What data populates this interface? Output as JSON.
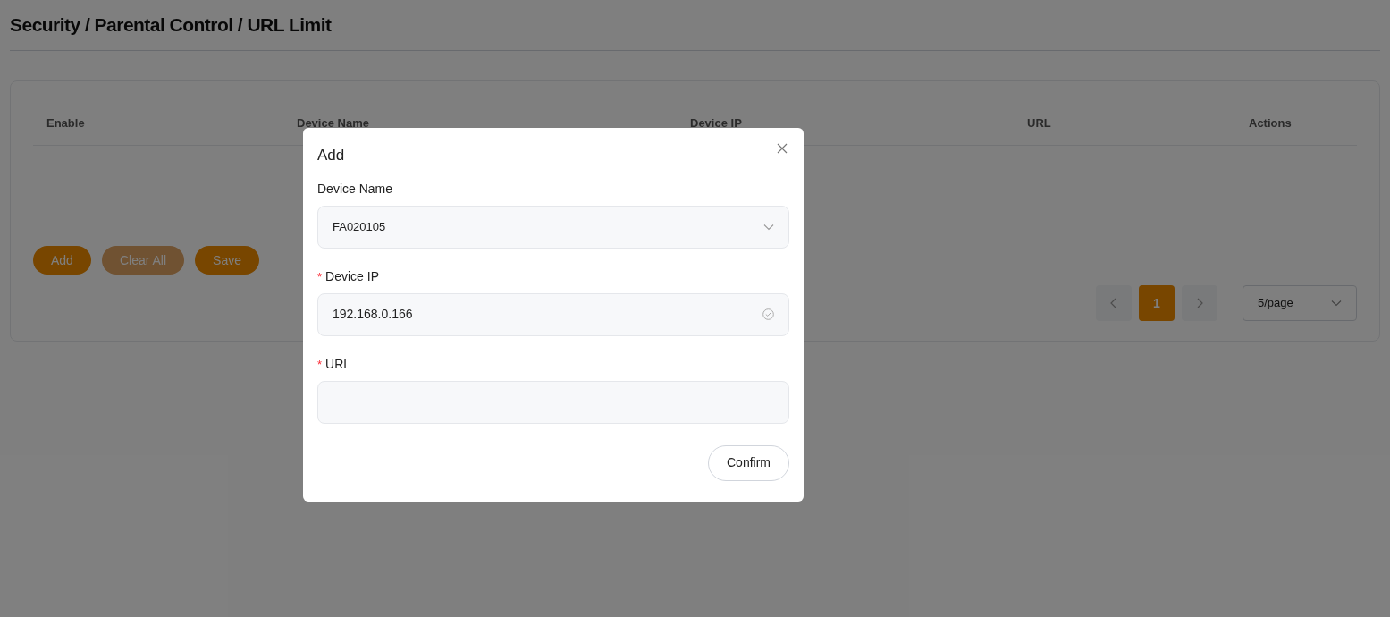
{
  "page_title": "Security / Parental Control / URL Limit",
  "table": {
    "columns": [
      "Enable",
      "Device Name",
      "Device IP",
      "URL",
      "Actions"
    ]
  },
  "buttons": [
    {
      "label": "Add",
      "disabled": false
    },
    {
      "label": "Clear All",
      "disabled": true
    },
    {
      "label": "Save",
      "disabled": false
    }
  ],
  "pagination": {
    "pages": [
      {
        "label": "1",
        "selected": true
      }
    ],
    "page_size": "5/page"
  },
  "dialog": {
    "title": "Add",
    "fields": [
      {
        "kind": "select",
        "label": "Device Name",
        "value": "FA020105"
      },
      {
        "kind": "text",
        "required_mark": "*",
        "label": "Device IP",
        "valid": true,
        "value": "192.168.0.166"
      },
      {
        "kind": "text",
        "required_mark": "*",
        "label": "URL",
        "valid": false
      }
    ],
    "confirm": "Confirm"
  }
}
